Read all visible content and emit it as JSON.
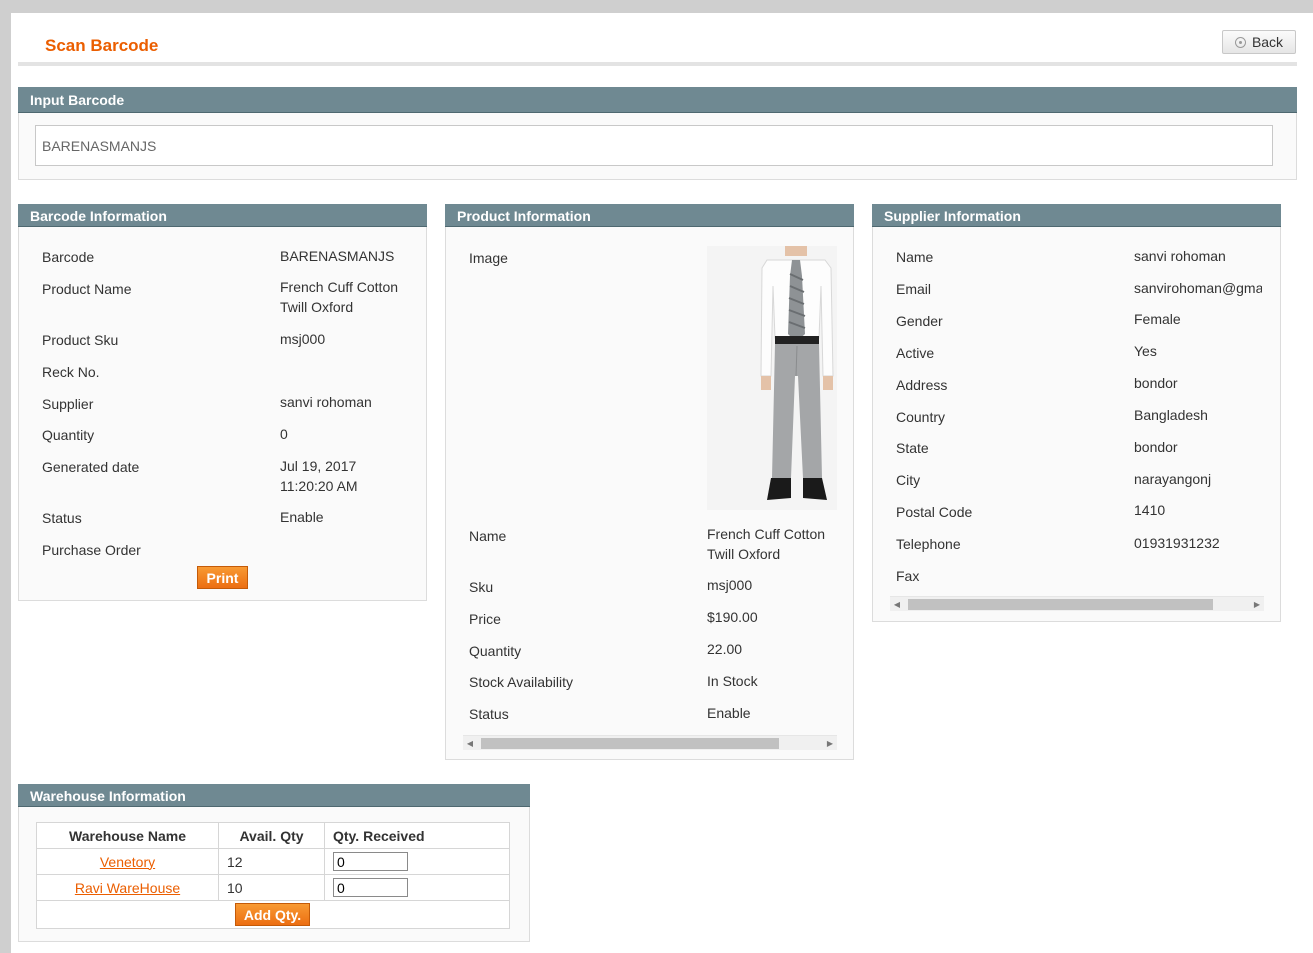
{
  "page": {
    "title": "Scan Barcode",
    "back_label": "Back"
  },
  "input_barcode": {
    "header": "Input Barcode",
    "value": "BARENASMANJS"
  },
  "barcode_info": {
    "header": "Barcode Information",
    "rows": [
      {
        "label": "Barcode",
        "value": "BARENASMANJS"
      },
      {
        "label": "Product Name",
        "value": "French Cuff Cotton Twill Oxford"
      },
      {
        "label": "Product Sku",
        "value": "msj000"
      },
      {
        "label": "Reck No.",
        "value": ""
      },
      {
        "label": "Supplier",
        "value": "sanvi rohoman"
      },
      {
        "label": "Quantity",
        "value": "0"
      },
      {
        "label": "Generated date",
        "value": "Jul 19, 2017 11:20:20 AM"
      },
      {
        "label": "Status",
        "value": "Enable"
      },
      {
        "label": "Purchase Order",
        "value": ""
      }
    ],
    "print_label": "Print"
  },
  "product_info": {
    "header": "Product Information",
    "image_label": "Image",
    "rows": [
      {
        "label": "Name",
        "value": "French Cuff Cotton Twill Oxford"
      },
      {
        "label": "Sku",
        "value": "msj000"
      },
      {
        "label": "Price",
        "value": "$190.00"
      },
      {
        "label": "Quantity",
        "value": "22.00"
      },
      {
        "label": "Stock Availability",
        "value": "In Stock"
      },
      {
        "label": "Status",
        "value": "Enable"
      }
    ]
  },
  "supplier_info": {
    "header": "Supplier Information",
    "rows": [
      {
        "label": "Name",
        "value": "sanvi rohoman"
      },
      {
        "label": "Email",
        "value": "sanvirohoman@gmail.com"
      },
      {
        "label": "Gender",
        "value": "Female"
      },
      {
        "label": "Active",
        "value": "Yes"
      },
      {
        "label": "Address",
        "value": "bondor"
      },
      {
        "label": "Country",
        "value": "Bangladesh"
      },
      {
        "label": "State",
        "value": "bondor"
      },
      {
        "label": "City",
        "value": "narayangonj"
      },
      {
        "label": "Postal Code",
        "value": "1410"
      },
      {
        "label": "Telephone",
        "value": "01931931232"
      },
      {
        "label": "Fax",
        "value": ""
      }
    ]
  },
  "warehouse_info": {
    "header": "Warehouse Information",
    "columns": [
      "Warehouse Name",
      "Avail. Qty",
      "Qty. Received"
    ],
    "rows": [
      {
        "name": "Venetory",
        "avail": "12",
        "received": "0"
      },
      {
        "name": "Ravi WareHouse",
        "avail": "10",
        "received": "0"
      }
    ],
    "add_label": "Add Qty."
  },
  "colors": {
    "accent": "#eb5e00",
    "section_header": "#6f8992",
    "button": "#f08020"
  },
  "icons": {
    "back": "circle-dot-icon",
    "scroll_left": "arrow-left-icon",
    "scroll_right": "arrow-right-icon"
  }
}
